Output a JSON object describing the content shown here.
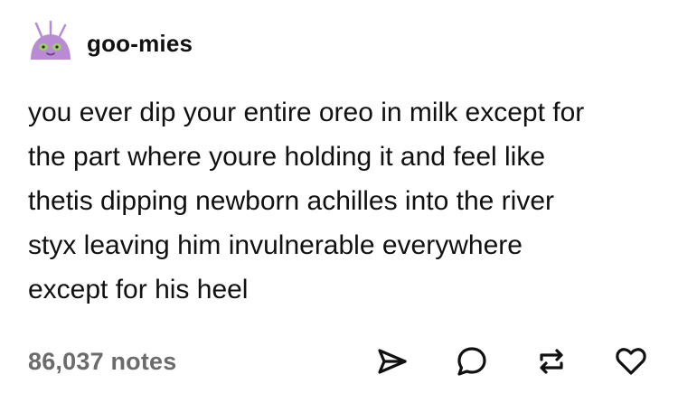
{
  "post": {
    "username": "goo-mies",
    "avatar_icon": "purple-blob-avatar-icon",
    "body_lines": [
      "you ever dip your entire oreo in milk except for",
      "the part where youre holding it and feel like",
      "thetis dipping newborn achilles into the river",
      "styx leaving him invulnerable everywhere",
      "except for his heel"
    ],
    "notes": "86,037 notes",
    "actions": [
      "share-icon",
      "reply-icon",
      "reblog-icon",
      "like-icon"
    ]
  },
  "colors": {
    "avatar": "#b98bd4",
    "text": "#111111",
    "notes": "#6b6b6b",
    "icons": "#111111"
  }
}
